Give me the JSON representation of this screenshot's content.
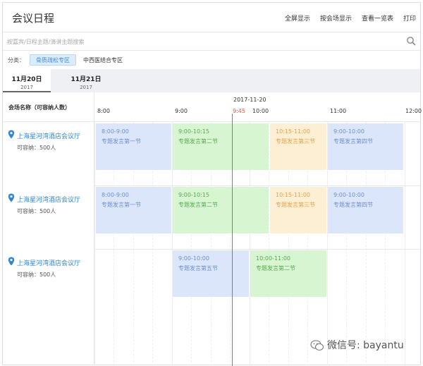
{
  "header": {
    "title": "会议日程",
    "actions": [
      "全屏显示",
      "按会场显示",
      "查看一览表",
      "打印"
    ]
  },
  "search": {
    "placeholder": "按嘉宾/日程主题/演讲主题搜索",
    "icon": "search-icon"
  },
  "category": {
    "label": "分类：",
    "active": "骨质疏松专区",
    "other": "中西医结合专区"
  },
  "dates": [
    {
      "day": "11月20日",
      "year": "2017",
      "active": true
    },
    {
      "day": "11月21日",
      "year": "2017",
      "active": false
    }
  ],
  "schedule": {
    "venue_header": "会场名称（可容纳人数）",
    "date": "2017-11-20",
    "hours": [
      "8:00",
      "9:00",
      "10:00",
      "11:00",
      "12:00"
    ],
    "now": "9:45",
    "accent_now": "#e2564c"
  },
  "venues": [
    {
      "name": "上海星河湾酒店会议厅",
      "capacity": "可容纳：500人",
      "sessions": [
        {
          "time": "8:00-9:00",
          "title": "专题发言第一节",
          "color": "blue"
        },
        {
          "time": "9:00-10:15",
          "title": "专题发言第二节",
          "color": "green"
        },
        {
          "time": "10:15-11:00",
          "title": "专题发言第三节",
          "color": "orange"
        },
        {
          "time": "9:00-10:00",
          "title": "专题发言第四节",
          "color": "blue"
        }
      ]
    },
    {
      "name": "上海星河湾酒店会议厅",
      "capacity": "可容纳：500人",
      "sessions": [
        {
          "time": "8:00-9:00",
          "title": "专题发言第一节",
          "color": "blue"
        },
        {
          "time": "9:00-10:15",
          "title": "专题发言第二节",
          "color": "green"
        },
        {
          "time": "10:15-11:00",
          "title": "专题发言第三节",
          "color": "orange"
        },
        {
          "time": "9:00-10:00",
          "title": "专题发言第四节",
          "color": "blue"
        }
      ]
    },
    {
      "name": "上海星河湾酒店会议厅",
      "capacity": "可容纳：500人",
      "sessions": [
        {
          "time": "9:00-10:00",
          "title": "专题发言第五节",
          "color": "blue"
        },
        {
          "time": "10:00-11:00",
          "title": "专题发言第二节",
          "color": "green"
        }
      ]
    }
  ],
  "watermark": "微信号: bayantu"
}
